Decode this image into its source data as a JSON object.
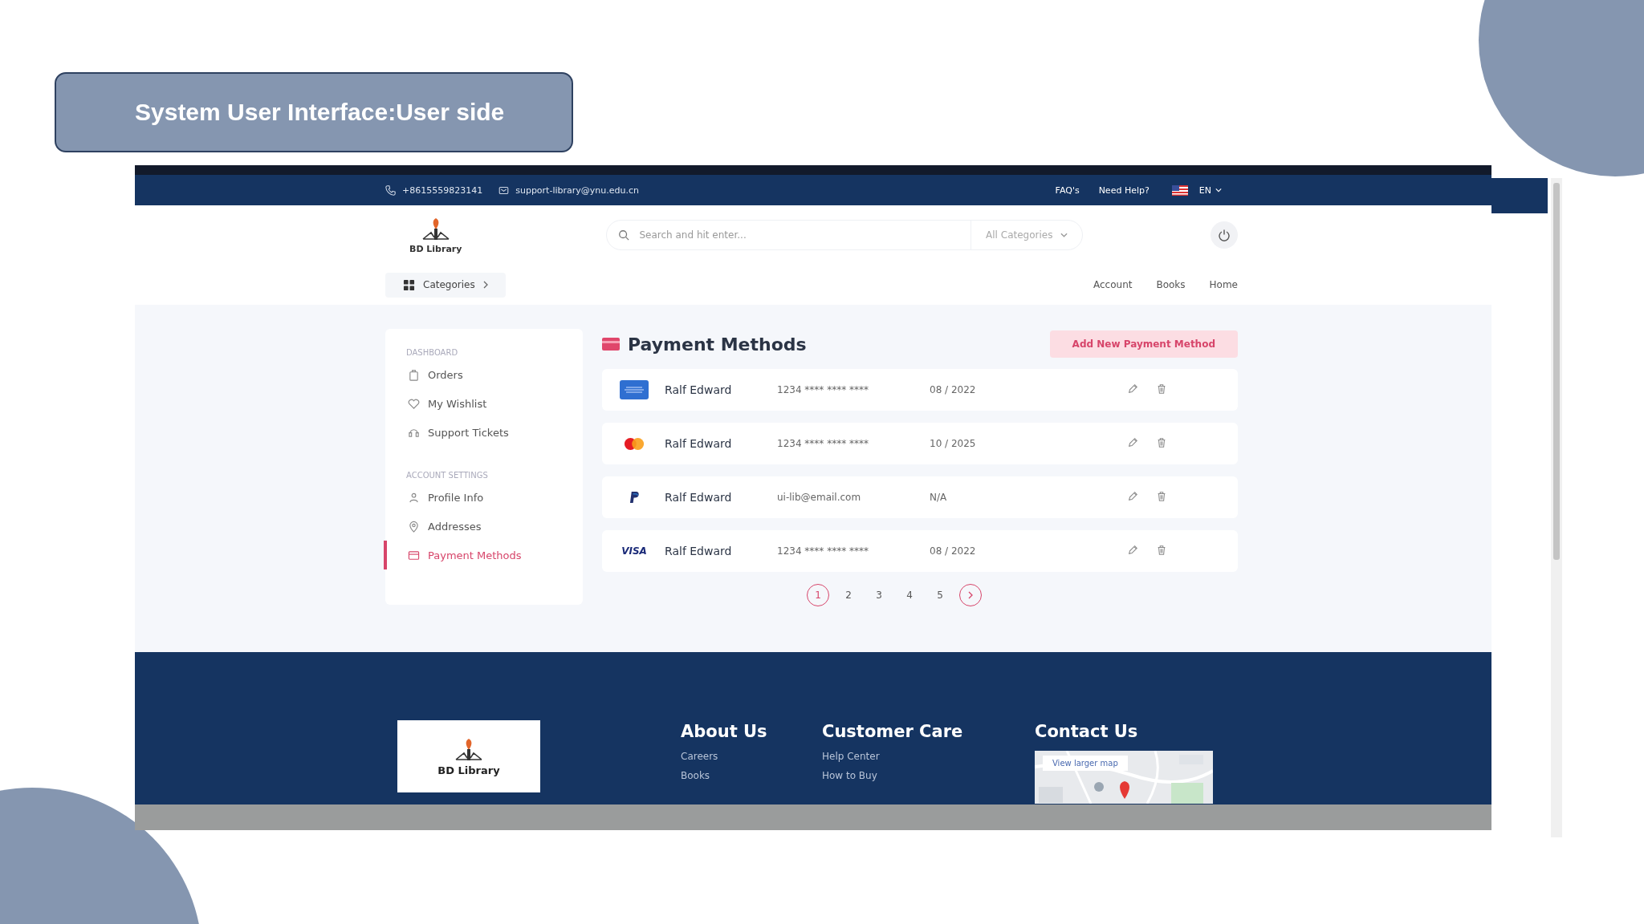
{
  "slide": {
    "title": "System User Interface:User side"
  },
  "topbar": {
    "phone": "+8615559823141",
    "email": "support-library@ynu.edu.cn",
    "links": [
      "FAQ's",
      "Need Help?"
    ],
    "language": "EN"
  },
  "header": {
    "logo": "BD Library",
    "search": {
      "placeholder": "Search and hit enter...",
      "category": "All Categories"
    },
    "categories_button": "Categories",
    "nav": [
      "Account",
      "Books",
      "Home"
    ]
  },
  "sidebar": {
    "sections": [
      {
        "heading": "DASHBOARD",
        "items": [
          {
            "label": "Orders",
            "selected": false
          },
          {
            "label": "My Wishlist",
            "selected": false
          },
          {
            "label": "Support Tickets",
            "selected": false
          }
        ]
      },
      {
        "heading": "ACCOUNT SETTINGS",
        "items": [
          {
            "label": "Profile Info",
            "selected": false
          },
          {
            "label": "Addresses",
            "selected": false
          },
          {
            "label": "Payment Methods",
            "selected": true
          }
        ]
      }
    ]
  },
  "main": {
    "title": "Payment Methods",
    "add_button": "Add New Payment Method",
    "methods": [
      {
        "kind": "amex",
        "name": "Ralf Edward",
        "number": "1234 **** **** ****",
        "expiry": "08 / 2022"
      },
      {
        "kind": "mastercard",
        "name": "Ralf Edward",
        "number": "1234 **** **** ****",
        "expiry": "10 / 2025"
      },
      {
        "kind": "paypal",
        "name": "Ralf Edward",
        "number": "ui-lib@email.com",
        "expiry": "N/A"
      },
      {
        "kind": "visa",
        "logo_text": "VISA",
        "name": "Ralf Edward",
        "number": "1234 **** **** ****",
        "expiry": "08 / 2022"
      }
    ]
  },
  "pagination": {
    "pages": [
      {
        "label": "1",
        "selected": true
      },
      {
        "label": "2",
        "selected": false
      },
      {
        "label": "3",
        "selected": false
      },
      {
        "label": "4",
        "selected": false
      },
      {
        "label": "5",
        "selected": false
      }
    ]
  },
  "footer": {
    "logo": "BD Library",
    "columns": [
      {
        "kind": "links",
        "title": "About Us",
        "links": [
          "Careers",
          "Books"
        ]
      },
      {
        "kind": "links",
        "title": "Customer Care",
        "links": [
          "Help Center",
          "How to Buy"
        ]
      },
      {
        "kind": "map",
        "title": "Contact Us",
        "map_button": "View larger map"
      }
    ]
  }
}
